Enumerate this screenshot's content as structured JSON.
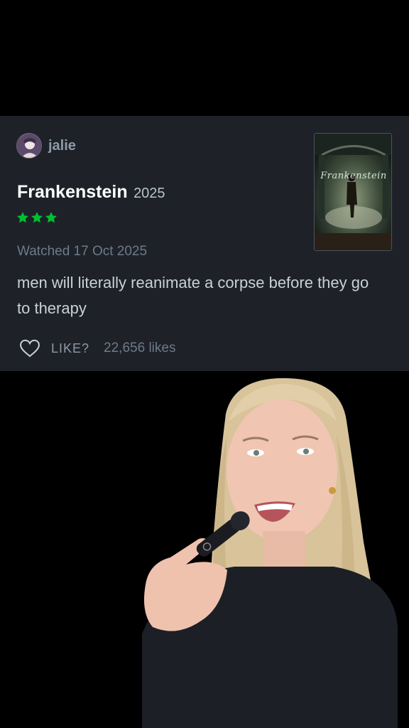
{
  "review_card": {
    "username": "jalie",
    "film_title": "Frankenstein",
    "film_year": "2025",
    "rating_stars": 3,
    "star_color": "#00c030",
    "watched_text": "Watched 17 Oct 2025",
    "review_text": "men will literally reanimate a corpse before they go to therapy",
    "like_label": "LIKE?",
    "like_count": "22,656 likes",
    "poster_title": "Frankenstein",
    "background_color": "#1e2228"
  },
  "icons": {
    "avatar": "user-avatar",
    "star": "star-icon",
    "like": "heart-outline-icon"
  }
}
